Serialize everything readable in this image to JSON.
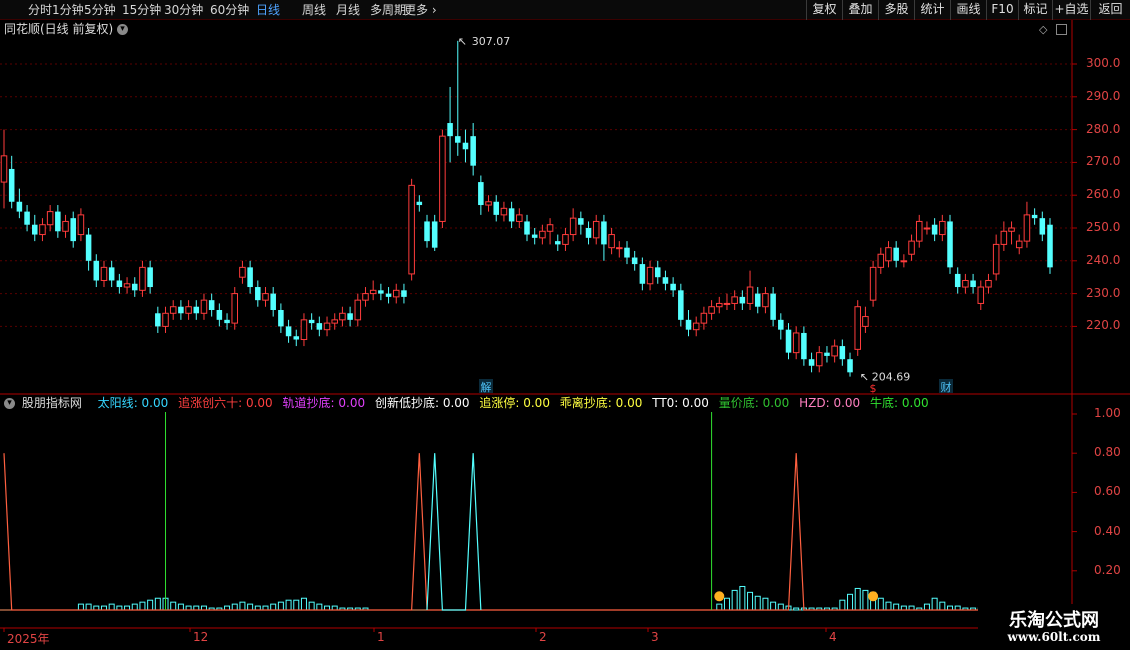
{
  "toolbar": {
    "periods": [
      "分时",
      "1分钟",
      "5分钟",
      "15分钟",
      "30分钟",
      "60分钟",
      "日线",
      "周线",
      "月线",
      "多周期",
      "更多"
    ],
    "active": "日线",
    "buttons": [
      "复权",
      "叠加",
      "多股",
      "统计",
      "画线",
      "F10",
      "标记",
      "+自选",
      "返回"
    ]
  },
  "price_panel": {
    "title": "同花顺(日线 前复权)",
    "y_ticks": [
      "300.0",
      "290.0",
      "280.0",
      "270.0",
      "260.0",
      "250.0",
      "240.0",
      "230.0",
      "220.0"
    ],
    "high_label": "307.07",
    "low_label": "204.69",
    "event_markers": [
      {
        "text": "解",
        "color": "#4fc3f7"
      },
      {
        "text": "财",
        "color": "#4fc3f7"
      },
      {
        "text": "$",
        "color": "#ff3030"
      }
    ]
  },
  "indicator_panel": {
    "name": "股朋指标网",
    "items": [
      {
        "label": "太阳线",
        "value": "0.00",
        "color": "#35d6ff"
      },
      {
        "label": "追涨创六十",
        "value": "0.00",
        "color": "#ff4040"
      },
      {
        "label": "轨道抄底",
        "value": "0.00",
        "color": "#e040fb"
      },
      {
        "label": "创新低抄底",
        "value": "0.00",
        "color": "#ffffff"
      },
      {
        "label": "追涨停",
        "value": "0.00",
        "color": "#ffff40"
      },
      {
        "label": "乖离抄底",
        "value": "0.00",
        "color": "#ffff40"
      },
      {
        "label": "TT0",
        "value": "0.00",
        "color": "#ffffff"
      },
      {
        "label": "量价底",
        "value": "0.00",
        "color": "#30c030"
      },
      {
        "label": "HZD",
        "value": "0.00",
        "color": "#ff80c0"
      },
      {
        "label": "牛底",
        "value": "0.00",
        "color": "#30e030"
      }
    ],
    "y_ticks": [
      "1.00",
      "0.80",
      "0.60",
      "0.40",
      "0.20"
    ]
  },
  "date_axis": {
    "labels": [
      "2025年",
      "12",
      "1",
      "2",
      "3",
      "4"
    ]
  },
  "watermark": {
    "title": "乐淘公式网",
    "url": "www.60lt.com"
  },
  "colors": {
    "up": "#ff3c3c",
    "down": "#54ffff",
    "grid": "#5a0000",
    "axis": "#b00000"
  },
  "chart_data": [
    {
      "type": "candlestick",
      "title": "同花顺(日线 前复权)",
      "ylim": [
        202,
        312
      ],
      "annotations": {
        "high": 307.07,
        "low": 204.69
      },
      "candles": [
        [
          264,
          272,
          256,
          280
        ],
        [
          268,
          258,
          256,
          272
        ],
        [
          258,
          255,
          253,
          262
        ],
        [
          255,
          251,
          249,
          257
        ],
        [
          251,
          248,
          246,
          254
        ],
        [
          248,
          251,
          246,
          253
        ],
        [
          251,
          255,
          249,
          257
        ],
        [
          255,
          249,
          247,
          257
        ],
        [
          249,
          252,
          247,
          254
        ],
        [
          253,
          246,
          244,
          255
        ],
        [
          248,
          254,
          246,
          256
        ],
        [
          248,
          240,
          237,
          250
        ],
        [
          240,
          234,
          232,
          242
        ],
        [
          234,
          238,
          232,
          240
        ],
        [
          238,
          234,
          232,
          240
        ],
        [
          234,
          232,
          230,
          236
        ],
        [
          232,
          233,
          230,
          235
        ],
        [
          233,
          231,
          229,
          235
        ],
        [
          231,
          238,
          229,
          240
        ],
        [
          238,
          232,
          230,
          240
        ],
        [
          224,
          220,
          218,
          226
        ],
        [
          220,
          224,
          218,
          226
        ],
        [
          224,
          226,
          222,
          228
        ],
        [
          226,
          224,
          222,
          228
        ],
        [
          224,
          226,
          222,
          228
        ],
        [
          226,
          224,
          222,
          228
        ],
        [
          224,
          228,
          222,
          230
        ],
        [
          228,
          225,
          223,
          230
        ],
        [
          225,
          222,
          220,
          227
        ],
        [
          222,
          221,
          219,
          224
        ],
        [
          221,
          230,
          219,
          232
        ],
        [
          235,
          238,
          233,
          240
        ],
        [
          238,
          232,
          230,
          240
        ],
        [
          232,
          228,
          226,
          234
        ],
        [
          228,
          230,
          226,
          232
        ],
        [
          230,
          225,
          223,
          232
        ],
        [
          225,
          220,
          218,
          227
        ],
        [
          220,
          217,
          215,
          222
        ],
        [
          217,
          216,
          214,
          219
        ],
        [
          216,
          222,
          214,
          224
        ],
        [
          222,
          221,
          219,
          224
        ],
        [
          221,
          219,
          217,
          223
        ],
        [
          219,
          221,
          217,
          223
        ],
        [
          221,
          222,
          219,
          224
        ],
        [
          222,
          224,
          220,
          226
        ],
        [
          224,
          222,
          220,
          226
        ],
        [
          222,
          228,
          220,
          230
        ],
        [
          228,
          230,
          226,
          232
        ],
        [
          230,
          231,
          228,
          234
        ],
        [
          231,
          230,
          228,
          233
        ],
        [
          230,
          229,
          227,
          232
        ],
        [
          229,
          231,
          227,
          233
        ],
        [
          231,
          229,
          227,
          233
        ],
        [
          236,
          263,
          234,
          265
        ],
        [
          258,
          257,
          255,
          260
        ],
        [
          252,
          246,
          244,
          254
        ],
        [
          252,
          244,
          243,
          254
        ],
        [
          252,
          278,
          250,
          280
        ],
        [
          282,
          278,
          270,
          293
        ],
        [
          278,
          276,
          272,
          307.07
        ],
        [
          276,
          274,
          270,
          280
        ],
        [
          278,
          269,
          266,
          282
        ],
        [
          264,
          257,
          254,
          266
        ],
        [
          257,
          258,
          255,
          260
        ],
        [
          258,
          254,
          252,
          260
        ],
        [
          254,
          256,
          252,
          258
        ],
        [
          256,
          252,
          250,
          258
        ],
        [
          252,
          254,
          250,
          256
        ],
        [
          252,
          248,
          246,
          254
        ],
        [
          248,
          247,
          245,
          250
        ],
        [
          247,
          249,
          245,
          251
        ],
        [
          249,
          251,
          245,
          253
        ],
        [
          246,
          245,
          243,
          248
        ],
        [
          245,
          248,
          243,
          250
        ],
        [
          248,
          253,
          246,
          256
        ],
        [
          253,
          251,
          248,
          255
        ],
        [
          250,
          247,
          245,
          252
        ],
        [
          247,
          252,
          245,
          254
        ],
        [
          252,
          245,
          240,
          254
        ],
        [
          244,
          248,
          242,
          250
        ],
        [
          244,
          244,
          241,
          246
        ],
        [
          244,
          241,
          239,
          246
        ],
        [
          241,
          239,
          237,
          243
        ],
        [
          239,
          233,
          231,
          241
        ],
        [
          233,
          238,
          231,
          240
        ],
        [
          238,
          235,
          233,
          240
        ],
        [
          235,
          233,
          231,
          237
        ],
        [
          233,
          231,
          229,
          235
        ],
        [
          231,
          222,
          220,
          233
        ],
        [
          222,
          219,
          217,
          225
        ],
        [
          219,
          221,
          217,
          223
        ],
        [
          221,
          224,
          219,
          226
        ],
        [
          224,
          226,
          222,
          228
        ],
        [
          226,
          227,
          224,
          229
        ],
        [
          227,
          227,
          225,
          230
        ],
        [
          227,
          229,
          225,
          231
        ],
        [
          229,
          227,
          225,
          231
        ],
        [
          227,
          232,
          225,
          237
        ],
        [
          230,
          226,
          224,
          232
        ],
        [
          226,
          230,
          224,
          232
        ],
        [
          230,
          222,
          220,
          232
        ],
        [
          222,
          219,
          216,
          224
        ],
        [
          219,
          212,
          210,
          221
        ],
        [
          212,
          218,
          210,
          220
        ],
        [
          218,
          210,
          208,
          220
        ],
        [
          210,
          208,
          206,
          212
        ],
        [
          208,
          212,
          206,
          214
        ],
        [
          212,
          211,
          209,
          214
        ],
        [
          211,
          214,
          209,
          216
        ],
        [
          214,
          210,
          208,
          216
        ],
        [
          210,
          206,
          204.69,
          212
        ],
        [
          213,
          226,
          211,
          228
        ],
        [
          220,
          223,
          218,
          226
        ],
        [
          228,
          238,
          226,
          240
        ],
        [
          238,
          242,
          236,
          244
        ],
        [
          240,
          244,
          238,
          246
        ],
        [
          244,
          240,
          238,
          246
        ],
        [
          240,
          240,
          238,
          242
        ],
        [
          242,
          246,
          240,
          248
        ],
        [
          246,
          252,
          244,
          254
        ],
        [
          250,
          250,
          248,
          252
        ],
        [
          251,
          248,
          246,
          253
        ],
        [
          248,
          252,
          246,
          254
        ],
        [
          252,
          238,
          236,
          254
        ],
        [
          236,
          232,
          230,
          238
        ],
        [
          232,
          234,
          230,
          236
        ],
        [
          234,
          232,
          230,
          236
        ],
        [
          227,
          232,
          225,
          234
        ],
        [
          232,
          234,
          230,
          236
        ],
        [
          236,
          245,
          234,
          248
        ],
        [
          245,
          249,
          243,
          252
        ],
        [
          249,
          250,
          245,
          252
        ],
        [
          244,
          246,
          242,
          248
        ],
        [
          246,
          254,
          244,
          258
        ],
        [
          254,
          253,
          251,
          256
        ],
        [
          253,
          248,
          246,
          255
        ],
        [
          251,
          238,
          236,
          253
        ]
      ]
    },
    {
      "type": "line",
      "title": "股朋指标网",
      "ylim": [
        0,
        1.1
      ],
      "series": [
        {
          "name": "追涨创六十",
          "values": [
            [
              0,
              0.8
            ],
            [
              1,
              0
            ],
            [
              53,
              0
            ],
            [
              54,
              0.8
            ],
            [
              55,
              0
            ],
            [
              102,
              0
            ],
            [
              103,
              0.8
            ],
            [
              104,
              0
            ],
            [
              128,
              0
            ]
          ]
        },
        {
          "name": "太阳线",
          "values": [
            [
              55,
              0
            ],
            [
              56,
              0.8
            ],
            [
              57,
              0
            ],
            [
              60,
              0
            ],
            [
              61,
              0.8
            ],
            [
              62,
              0
            ]
          ]
        },
        {
          "name": "量价底",
          "values": [
            [
              21,
              1.0
            ],
            [
              92,
              1.0
            ]
          ]
        }
      ],
      "volume_bars": [
        0,
        0,
        0,
        0,
        0,
        0,
        0,
        0,
        0,
        0,
        0.03,
        0.03,
        0.02,
        0.02,
        0.03,
        0.02,
        0.02,
        0.03,
        0.04,
        0.05,
        0.06,
        0.06,
        0.04,
        0.03,
        0.02,
        0.02,
        0.02,
        0.01,
        0.01,
        0.02,
        0.03,
        0.04,
        0.03,
        0.02,
        0.02,
        0.03,
        0.04,
        0.05,
        0.05,
        0.06,
        0.04,
        0.03,
        0.02,
        0.02,
        0.01,
        0.01,
        0.01,
        0.01,
        0,
        0,
        0,
        0,
        0,
        0,
        0,
        0,
        0,
        0,
        0,
        0,
        0,
        0,
        0,
        0,
        0,
        0,
        0,
        0,
        0,
        0,
        0,
        0,
        0,
        0,
        0,
        0,
        0,
        0,
        0,
        0,
        0,
        0,
        0,
        0,
        0,
        0,
        0,
        0,
        0,
        0,
        0,
        0,
        0,
        0.03,
        0.06,
        0.1,
        0.12,
        0.09,
        0.07,
        0.06,
        0.04,
        0.03,
        0.02,
        0.01,
        0.01,
        0.01,
        0.01,
        0.01,
        0.01,
        0.05,
        0.08,
        0.11,
        0.1,
        0.09,
        0.06,
        0.04,
        0.03,
        0.02,
        0.02,
        0.01,
        0.03,
        0.06,
        0.04,
        0.02,
        0.02,
        0.01,
        0.01,
        0.01,
        0.01
      ]
    }
  ]
}
